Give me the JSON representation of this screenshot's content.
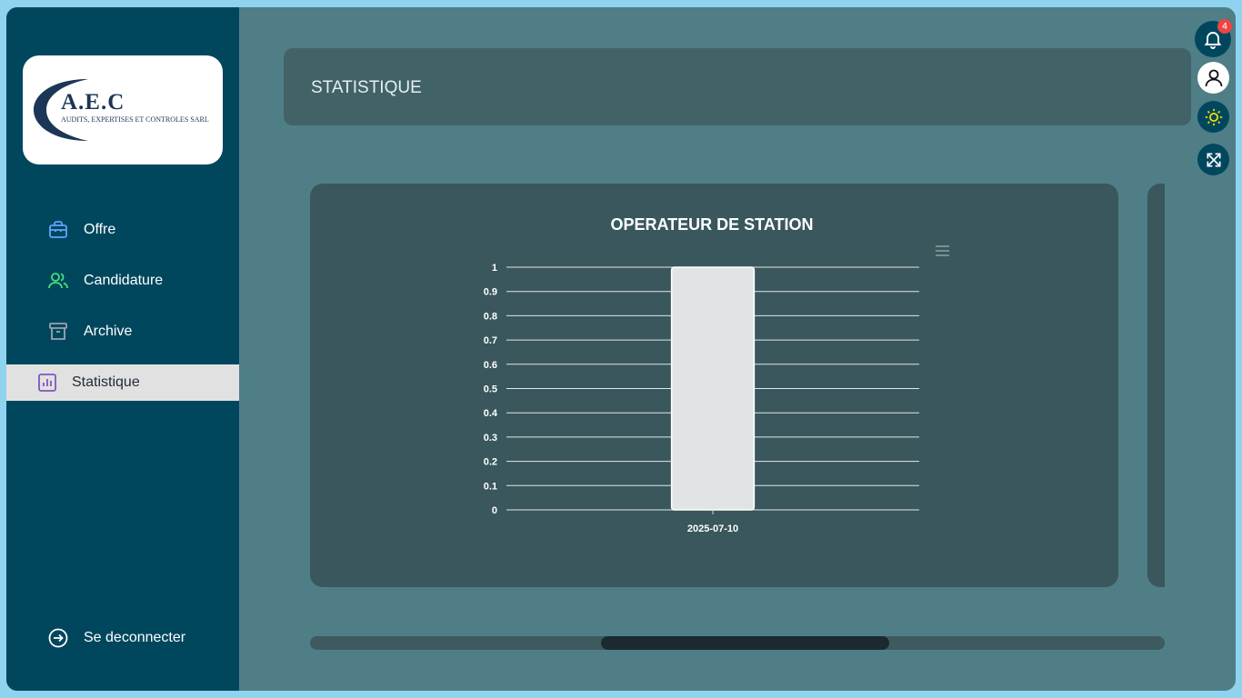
{
  "brand": {
    "logo_title": "A.E.C",
    "logo_subtitle": "AUDITS, EXPERTISES ET CONTROLES SARL"
  },
  "sidebar": {
    "items": [
      {
        "label": "Offre",
        "icon": "briefcase-icon",
        "color": "#60a5fa"
      },
      {
        "label": "Candidature",
        "icon": "users-icon",
        "color": "#4ade80"
      },
      {
        "label": "Archive",
        "icon": "archive-icon",
        "color": "#9ca3af"
      },
      {
        "label": "Statistique",
        "icon": "bar-chart-icon",
        "color": "#7e57c2",
        "active": true
      }
    ],
    "logout_label": "Se deconnecter"
  },
  "header": {
    "title": "STATISTIQUE"
  },
  "notifications": {
    "count": "4"
  },
  "chart_data": {
    "type": "bar",
    "title": "OPERATEUR DE STATION",
    "categories": [
      "2025-07-10"
    ],
    "values": [
      1
    ],
    "ylim": [
      0,
      1
    ],
    "yticks": [
      "0",
      "0.1",
      "0.2",
      "0.3",
      "0.4",
      "0.5",
      "0.6",
      "0.7",
      "0.8",
      "0.9",
      "1"
    ],
    "grid": true,
    "bar_color": "#e1e4e5",
    "menu_icon": "hamburger-menu-icon"
  },
  "colors": {
    "sidebar": "#00475e",
    "background": "#4f7e87",
    "accent_badge": "#ef4444",
    "sun_icon": "#f5e000"
  }
}
